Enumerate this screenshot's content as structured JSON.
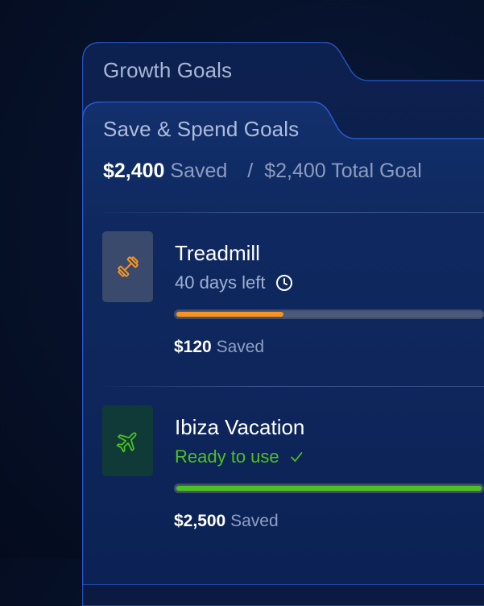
{
  "folders": {
    "back_title": "Growth Goals",
    "front_title": "Save & Spend Goals"
  },
  "summary": {
    "saved_amount": "$2,400",
    "saved_label": "Saved",
    "separator": "/",
    "goal_amount": "$2,400",
    "goal_label": "Total Goal"
  },
  "goals": [
    {
      "name": "Treadmill",
      "status": "40 days left",
      "status_icon": "clock-icon",
      "icon": "dumbbell-icon",
      "accent": "#f7931e",
      "progress": 0.35,
      "saved_amount": "$120",
      "saved_label": "Saved"
    },
    {
      "name": "Ibiza Vacation",
      "status": "Ready to use",
      "status_icon": "check-icon",
      "icon": "airplane-icon",
      "accent": "#4cc21d",
      "progress": 1.0,
      "saved_amount": "$2,500",
      "saved_label": "Saved"
    }
  ]
}
